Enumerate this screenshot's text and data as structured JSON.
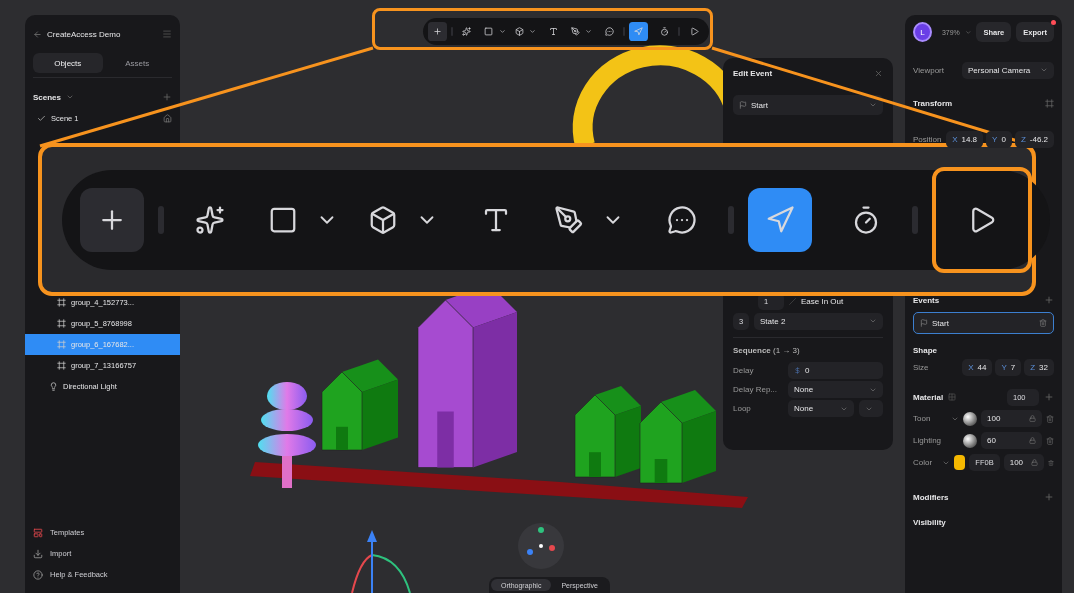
{
  "project": {
    "title": "CreateAccess Demo"
  },
  "sidebar_tabs": [
    {
      "label": "Objects",
      "selected": true
    },
    {
      "label": "Assets",
      "selected": false
    }
  ],
  "scenes": {
    "title": "Scenes",
    "items": [
      {
        "label": "Scene 1",
        "checked": true
      }
    ]
  },
  "objects": [
    {
      "kind": "mesh",
      "label": "group_4_152773...",
      "selected": false
    },
    {
      "kind": "mesh",
      "label": "group_5_8768998",
      "selected": false
    },
    {
      "kind": "mesh",
      "label": "group_6_167682...",
      "selected": true
    },
    {
      "kind": "mesh",
      "label": "group_7_13166757",
      "selected": false
    },
    {
      "kind": "light",
      "label": "Directional Light",
      "selected": false
    }
  ],
  "footer_links": [
    "Templates",
    "Import",
    "Help & Feedback"
  ],
  "toolbar": {
    "groups": [
      {
        "tools": [
          {
            "selected": false,
            "menu": false
          }
        ]
      },
      {
        "tools": [
          {
            "selected": false,
            "menu": false
          },
          {
            "selected": false,
            "menu": true
          },
          {
            "selected": false,
            "menu": true
          },
          {
            "selected": false,
            "menu": false
          },
          {
            "selected": false,
            "menu": true
          },
          {
            "selected": false,
            "menu": false
          }
        ]
      },
      {
        "tools": [
          {
            "selected": true,
            "menu": false
          },
          {
            "selected": false,
            "menu": false
          }
        ]
      },
      {
        "tools": [
          {
            "selected": false,
            "menu": false
          }
        ]
      }
    ]
  },
  "callout": {
    "toolbar": {
      "groups": [
        {
          "tools": [
            {
              "selected": false,
              "menu": false
            }
          ]
        },
        {
          "tools": [
            {
              "selected": false,
              "menu": false
            },
            {
              "selected": false,
              "menu": true
            },
            {
              "selected": false,
              "menu": true
            },
            {
              "selected": false,
              "menu": false
            },
            {
              "selected": false,
              "menu": true
            },
            {
              "selected": false,
              "menu": false
            }
          ]
        },
        {
          "tools": [
            {
              "selected": true,
              "menu": false
            },
            {
              "selected": false,
              "menu": false
            }
          ]
        },
        {
          "tools": [
            {
              "selected": false,
              "menu": false
            }
          ]
        }
      ]
    }
  },
  "view_modes": [
    {
      "label": "Orthographic",
      "selected": true
    },
    {
      "label": "Perspective",
      "selected": false
    }
  ],
  "edit_event": {
    "title": "Edit Event",
    "trigger": "Start",
    "transition": {
      "step": "1",
      "easing": "Ease In Out"
    },
    "target": {
      "index": "3",
      "state": "State 2"
    },
    "sequence": "**Sequence** (1 → 3)",
    "fields": [
      {
        "label": "Delay",
        "kind": "number",
        "value": "0"
      },
      {
        "label": "Delay Rep...",
        "kind": "select",
        "value": "None"
      },
      {
        "label": "Loop",
        "kind": "split-select",
        "value": "None"
      }
    ]
  },
  "inspector": {
    "avatar": "L",
    "zoom": "379%",
    "actions": [
      {
        "label": "Share",
        "badge": false
      },
      {
        "label": "Export",
        "badge": true
      }
    ],
    "viewport": {
      "label": "Viewport",
      "value": "Personal Camera"
    },
    "transform": {
      "title": "Transform",
      "position": {
        "label": "Position",
        "values": [
          {
            "axis": "X",
            "value": "14.8"
          },
          {
            "axis": "Y",
            "value": "0"
          },
          {
            "axis": "Z",
            "value": "-46.2"
          }
        ]
      }
    },
    "events": {
      "title": "Events",
      "items": [
        "Start"
      ]
    },
    "shape": {
      "title": "Shape",
      "size": {
        "label": "Size",
        "values": [
          {
            "axis": "X",
            "value": "44"
          },
          {
            "axis": "Y",
            "value": "7"
          },
          {
            "axis": "Z",
            "value": "32"
          }
        ]
      }
    },
    "material": {
      "title": "Material",
      "opacity": "100",
      "layers": [
        {
          "label": "Toon",
          "kind": "shader",
          "menu": true,
          "value": "100"
        },
        {
          "label": "Lighting",
          "kind": "shader",
          "menu": false,
          "value": "60"
        },
        {
          "label": "Color",
          "kind": "color",
          "menu": true,
          "color": "#f5b800",
          "hex": "FF0B",
          "value": "100"
        }
      ]
    },
    "modifiers": {
      "title": "Modifiers"
    },
    "visibility": {
      "title": "Visibility"
    }
  }
}
